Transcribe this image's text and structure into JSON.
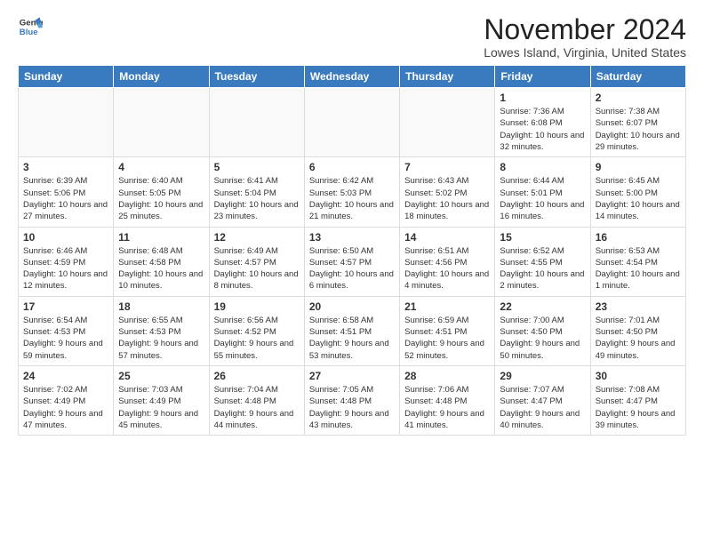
{
  "logo": {
    "general": "General",
    "blue": "Blue"
  },
  "header": {
    "title": "November 2024",
    "subtitle": "Lowes Island, Virginia, United States"
  },
  "weekdays": [
    "Sunday",
    "Monday",
    "Tuesday",
    "Wednesday",
    "Thursday",
    "Friday",
    "Saturday"
  ],
  "weeks": [
    [
      {
        "day": "",
        "info": ""
      },
      {
        "day": "",
        "info": ""
      },
      {
        "day": "",
        "info": ""
      },
      {
        "day": "",
        "info": ""
      },
      {
        "day": "",
        "info": ""
      },
      {
        "day": "1",
        "info": "Sunrise: 7:36 AM\nSunset: 6:08 PM\nDaylight: 10 hours and 32 minutes."
      },
      {
        "day": "2",
        "info": "Sunrise: 7:38 AM\nSunset: 6:07 PM\nDaylight: 10 hours and 29 minutes."
      }
    ],
    [
      {
        "day": "3",
        "info": "Sunrise: 6:39 AM\nSunset: 5:06 PM\nDaylight: 10 hours and 27 minutes."
      },
      {
        "day": "4",
        "info": "Sunrise: 6:40 AM\nSunset: 5:05 PM\nDaylight: 10 hours and 25 minutes."
      },
      {
        "day": "5",
        "info": "Sunrise: 6:41 AM\nSunset: 5:04 PM\nDaylight: 10 hours and 23 minutes."
      },
      {
        "day": "6",
        "info": "Sunrise: 6:42 AM\nSunset: 5:03 PM\nDaylight: 10 hours and 21 minutes."
      },
      {
        "day": "7",
        "info": "Sunrise: 6:43 AM\nSunset: 5:02 PM\nDaylight: 10 hours and 18 minutes."
      },
      {
        "day": "8",
        "info": "Sunrise: 6:44 AM\nSunset: 5:01 PM\nDaylight: 10 hours and 16 minutes."
      },
      {
        "day": "9",
        "info": "Sunrise: 6:45 AM\nSunset: 5:00 PM\nDaylight: 10 hours and 14 minutes."
      }
    ],
    [
      {
        "day": "10",
        "info": "Sunrise: 6:46 AM\nSunset: 4:59 PM\nDaylight: 10 hours and 12 minutes."
      },
      {
        "day": "11",
        "info": "Sunrise: 6:48 AM\nSunset: 4:58 PM\nDaylight: 10 hours and 10 minutes."
      },
      {
        "day": "12",
        "info": "Sunrise: 6:49 AM\nSunset: 4:57 PM\nDaylight: 10 hours and 8 minutes."
      },
      {
        "day": "13",
        "info": "Sunrise: 6:50 AM\nSunset: 4:57 PM\nDaylight: 10 hours and 6 minutes."
      },
      {
        "day": "14",
        "info": "Sunrise: 6:51 AM\nSunset: 4:56 PM\nDaylight: 10 hours and 4 minutes."
      },
      {
        "day": "15",
        "info": "Sunrise: 6:52 AM\nSunset: 4:55 PM\nDaylight: 10 hours and 2 minutes."
      },
      {
        "day": "16",
        "info": "Sunrise: 6:53 AM\nSunset: 4:54 PM\nDaylight: 10 hours and 1 minute."
      }
    ],
    [
      {
        "day": "17",
        "info": "Sunrise: 6:54 AM\nSunset: 4:53 PM\nDaylight: 9 hours and 59 minutes."
      },
      {
        "day": "18",
        "info": "Sunrise: 6:55 AM\nSunset: 4:53 PM\nDaylight: 9 hours and 57 minutes."
      },
      {
        "day": "19",
        "info": "Sunrise: 6:56 AM\nSunset: 4:52 PM\nDaylight: 9 hours and 55 minutes."
      },
      {
        "day": "20",
        "info": "Sunrise: 6:58 AM\nSunset: 4:51 PM\nDaylight: 9 hours and 53 minutes."
      },
      {
        "day": "21",
        "info": "Sunrise: 6:59 AM\nSunset: 4:51 PM\nDaylight: 9 hours and 52 minutes."
      },
      {
        "day": "22",
        "info": "Sunrise: 7:00 AM\nSunset: 4:50 PM\nDaylight: 9 hours and 50 minutes."
      },
      {
        "day": "23",
        "info": "Sunrise: 7:01 AM\nSunset: 4:50 PM\nDaylight: 9 hours and 49 minutes."
      }
    ],
    [
      {
        "day": "24",
        "info": "Sunrise: 7:02 AM\nSunset: 4:49 PM\nDaylight: 9 hours and 47 minutes."
      },
      {
        "day": "25",
        "info": "Sunrise: 7:03 AM\nSunset: 4:49 PM\nDaylight: 9 hours and 45 minutes."
      },
      {
        "day": "26",
        "info": "Sunrise: 7:04 AM\nSunset: 4:48 PM\nDaylight: 9 hours and 44 minutes."
      },
      {
        "day": "27",
        "info": "Sunrise: 7:05 AM\nSunset: 4:48 PM\nDaylight: 9 hours and 43 minutes."
      },
      {
        "day": "28",
        "info": "Sunrise: 7:06 AM\nSunset: 4:48 PM\nDaylight: 9 hours and 41 minutes."
      },
      {
        "day": "29",
        "info": "Sunrise: 7:07 AM\nSunset: 4:47 PM\nDaylight: 9 hours and 40 minutes."
      },
      {
        "day": "30",
        "info": "Sunrise: 7:08 AM\nSunset: 4:47 PM\nDaylight: 9 hours and 39 minutes."
      }
    ]
  ]
}
